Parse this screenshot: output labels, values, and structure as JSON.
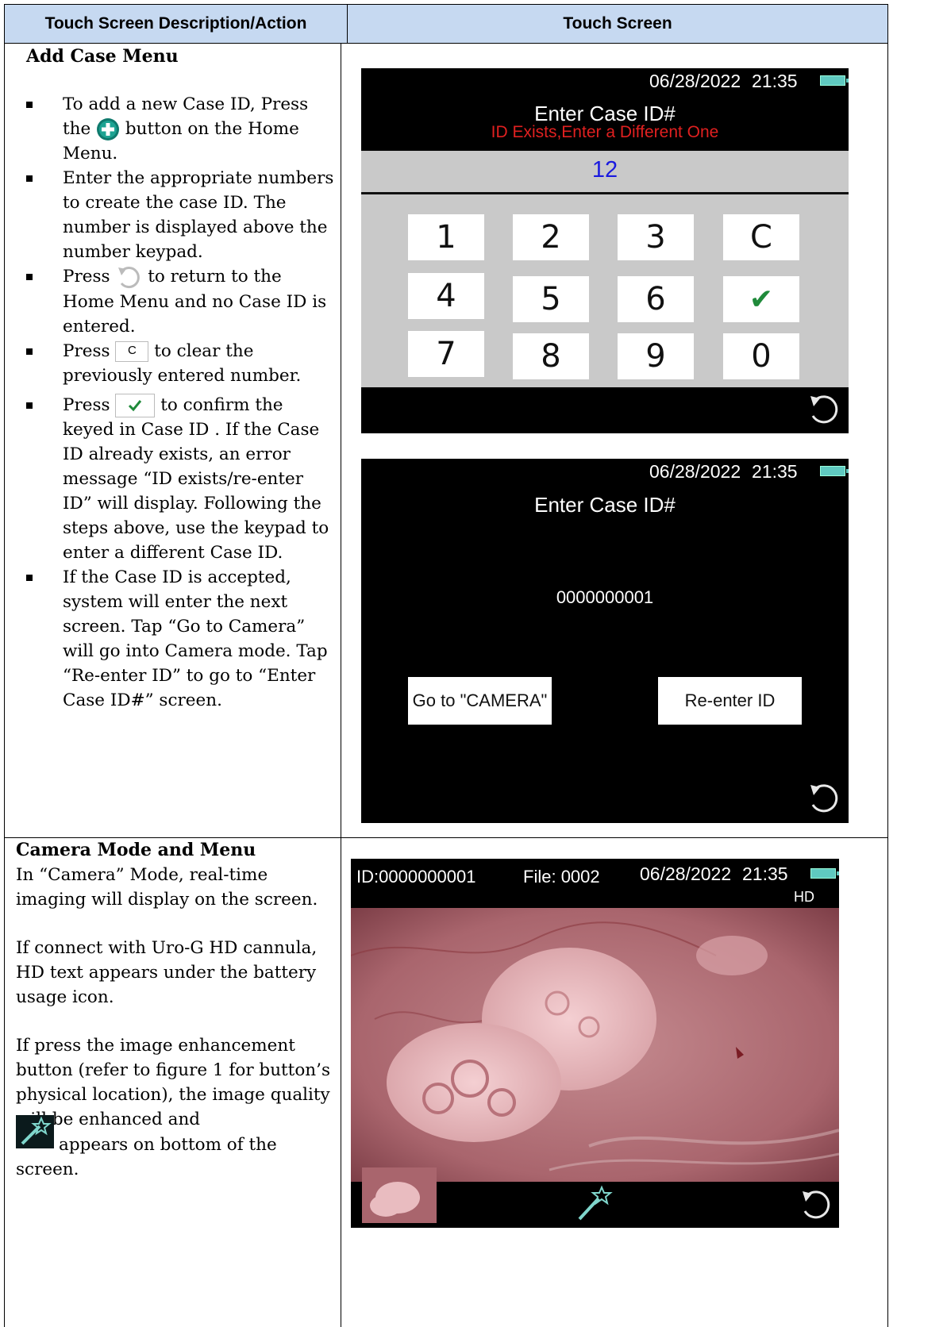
{
  "table": {
    "col1_header": "Touch Screen Description/Action",
    "col2_header": "Touch Screen"
  },
  "section1": {
    "title": "Add Case Menu",
    "bullets": {
      "b1_a": "To add a new Case ID, Press the",
      "b1_b": "button on the Home Menu.",
      "b2": "Enter the appropriate numbers to create the case ID. The number is displayed above the number keypad.",
      "b3_a": "Press",
      "b3_b": "to return to the Home Menu and no Case ID is entered.",
      "b4_a": "Press",
      "b4_b": "to clear the previously entered number.",
      "b4_key": "C",
      "b5_a": "Press",
      "b5_b": "to confirm the keyed in Case ID . If the Case ID already exists, an error message “ID exists/re-enter ID” will display. Following the steps above, use the keypad to enter a different Case ID.",
      "b6": "If the Case ID is accepted, system will enter the next screen. Tap “Go to Camera” will go into Camera mode. Tap “Re-enter ID” to go to “Enter Case ID#” screen."
    }
  },
  "screen1": {
    "date": "06/28/2022",
    "time": "21:35",
    "title": "Enter Case ID#",
    "error": "ID Exists,Enter a Different One",
    "value": "12",
    "keys": [
      "1",
      "2",
      "3",
      "C",
      "4",
      "5",
      "6",
      "✔",
      "7",
      "8",
      "9",
      "0"
    ]
  },
  "screen2": {
    "date": "06/28/2022",
    "time": "21:35",
    "title": "Enter Case ID#",
    "case_id": "0000000001",
    "go_button": "Go to \"CAMERA\"",
    "reenter_button": "Re-enter ID"
  },
  "section2": {
    "title": "Camera Mode and Menu",
    "p1": "In “Camera” Mode, real-time imaging will display on the screen.",
    "p2": "If connect with Uro-G HD cannula, HD text appears under the battery usage icon.",
    "p3": "If press the image enhancement button (refer to figure 1 for button’s physical location), the image quality will be enhanced and",
    "p3_b": "appears on bottom of the screen."
  },
  "screen3": {
    "id_label": "ID:",
    "id_value": "0000000001",
    "file_label": "File:",
    "file_value": "0002",
    "date": "06/28/2022",
    "time": "21:35",
    "hd": "HD"
  },
  "colors": {
    "header_bg": "#c6d9f1",
    "error_red": "#e02020",
    "value_blue": "#1a1adf",
    "check_green": "#1f8a3a",
    "battery": "#5fc9c0"
  }
}
